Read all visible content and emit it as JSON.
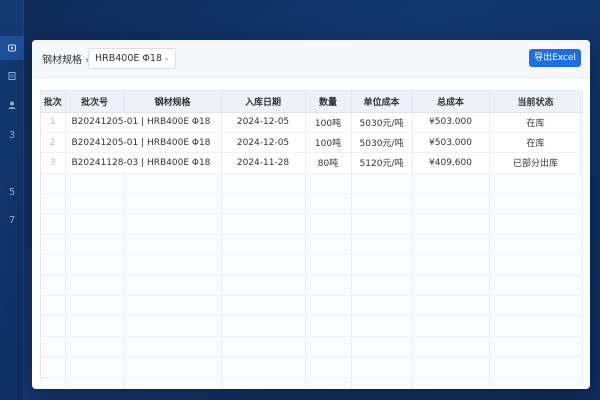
{
  "sidebar": {
    "items": [
      {
        "icon": "home-icon",
        "label": ""
      },
      {
        "icon": "document-icon",
        "label": ""
      },
      {
        "icon": "user-icon",
        "label": ""
      },
      {
        "icon": "",
        "label": "3"
      },
      {
        "icon": "",
        "label": "5"
      },
      {
        "icon": "",
        "label": "7"
      }
    ]
  },
  "toolbar": {
    "filter_label": "钢材规格 =",
    "select_value": "HRB400E  Φ18",
    "export_label": "导出Excel"
  },
  "table": {
    "headers": [
      "批次",
      "批次号",
      "钢材规格",
      "入库日期",
      "数量",
      "单位成本",
      "总成本",
      "当前状态"
    ],
    "rows": [
      {
        "idx": "1",
        "batch": "B20241205-01",
        "spec": "HRB400E Φ18",
        "date": "2024-12-05",
        "qty": "100吨",
        "unit_cost": "5030元/吨",
        "total": "¥503.000",
        "status": "在库"
      },
      {
        "idx": "2",
        "batch": "B20241205-01",
        "spec": "HRB400E Φ18",
        "date": "2024-12-05",
        "qty": "100吨",
        "unit_cost": "5030元/吨",
        "total": "¥503.000",
        "status": "在库"
      },
      {
        "idx": "3",
        "batch": "B20241128-03",
        "spec": "HRB400E Φ18",
        "date": "2024-11-28",
        "qty": "80吨",
        "unit_cost": "5120元/吨",
        "total": "¥409,600",
        "status": "已部分出库"
      }
    ]
  },
  "colors": {
    "accent": "#1f6fe0",
    "background": "#0d2a57"
  }
}
